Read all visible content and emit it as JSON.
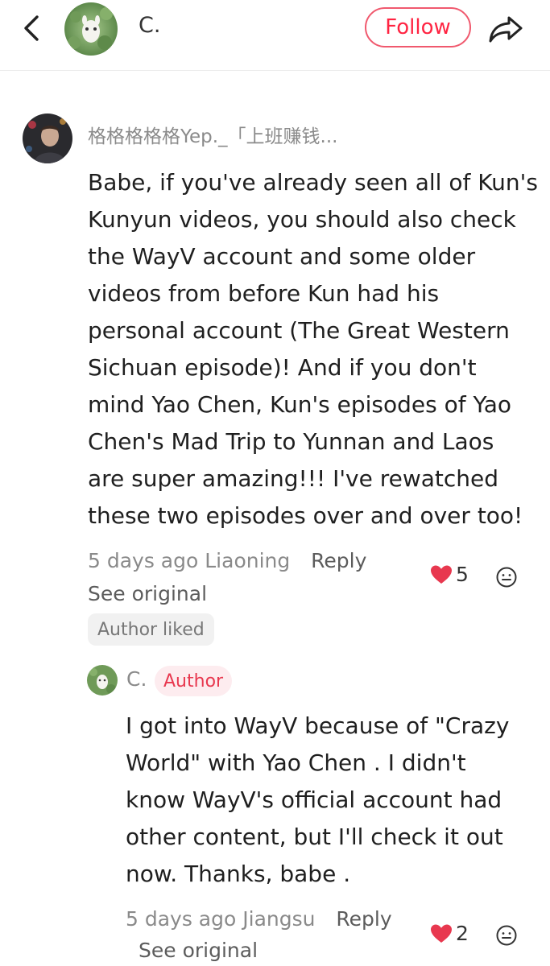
{
  "header": {
    "user_name": "C.",
    "follow_label": "Follow",
    "icons": [
      "back-arrow-icon",
      "share-icon"
    ]
  },
  "colors": {
    "accent": "#ff2442",
    "heart": "#e8384f",
    "muted_text": "#8a8a8a"
  },
  "comment": {
    "user_name": "格格格格格Yep._「上班赚钱...",
    "text": "Babe, if you've already seen all of Kun's\nKunyun videos, you should also check\nthe WayV account and some older\nvideos from before Kun had his\npersonal account (The Great Western\nSichuan episode)! And if you don't\nmind Yao Chen, Kun's episodes of Yao\nChen's Mad Trip to Yunnan and Laos\nare super amazing!!!  I've rewatched\nthese two episodes over and over too!",
    "time": "5 days ago",
    "location": "Liaoning",
    "reply_label": "Reply",
    "see_original": "See original",
    "author_liked": "Author liked",
    "likes": "5"
  },
  "reply": {
    "user_name": "C.",
    "badge": "Author",
    "text": "I got into WayV because of \"Crazy\nWorld\" with Yao Chen . I didn't\nknow WayV's official account had\nother content, but I'll check it out\nnow. Thanks, babe .",
    "time": "5 days ago",
    "location": "Jiangsu",
    "reply_label": "Reply",
    "see_original": "See original",
    "likes": "2"
  }
}
